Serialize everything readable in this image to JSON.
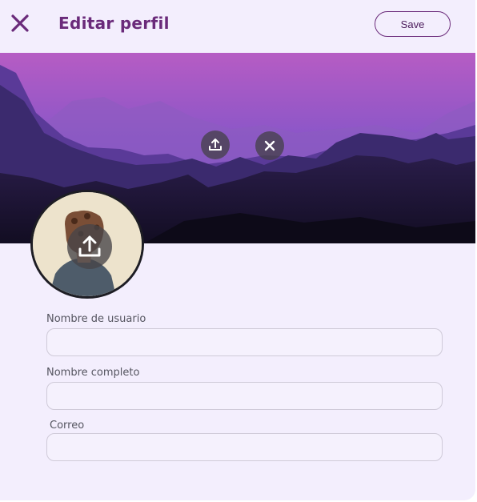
{
  "header": {
    "close_icon": "close-icon",
    "title": "Editar perfil",
    "save_label": "Save"
  },
  "banner": {
    "upload_icon": "upload-icon",
    "remove_icon": "close-icon"
  },
  "avatar": {
    "upload_icon": "upload-icon"
  },
  "form": {
    "fields": [
      {
        "label": "Nombre de usuario",
        "value": ""
      },
      {
        "label": "Nombre completo",
        "value": ""
      },
      {
        "label": "Correo",
        "value": ""
      }
    ]
  },
  "colors": {
    "accent": "#6a2a7a",
    "card_background": "#f3eefd",
    "input_border": "#cfcad8"
  }
}
